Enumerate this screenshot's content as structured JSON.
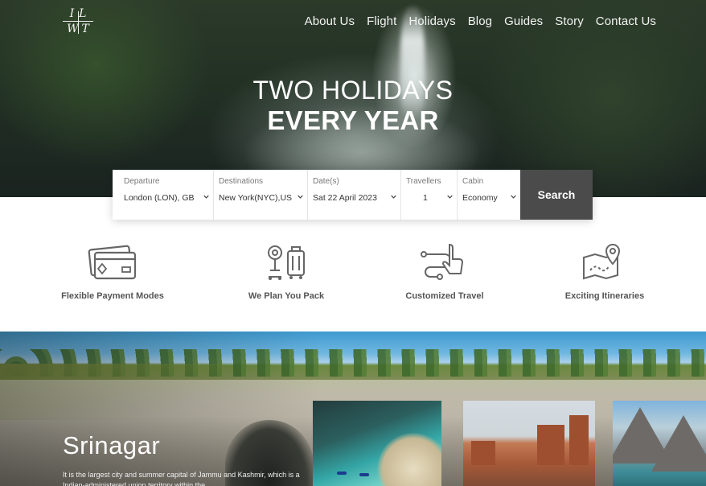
{
  "nav": {
    "logo_text": "IL WT",
    "links": [
      "About Us",
      "Flight",
      "Holidays",
      "Blog",
      "Guides",
      "Story",
      "Contact Us"
    ]
  },
  "hero": {
    "line1": "TWO HOLIDAYS",
    "line2": "EVERY YEAR"
  },
  "search": {
    "departure": {
      "label": "Departure",
      "value": "London (LON), GB"
    },
    "destinations": {
      "label": "Destinations",
      "value": "New York(NYC),US"
    },
    "dates": {
      "label": "Date(s)",
      "value": "Sat 22 April 2023"
    },
    "travellers": {
      "label": "Travellers",
      "value": "1"
    },
    "cabin": {
      "label": "Cabin",
      "value": "Economy"
    },
    "button": "Search"
  },
  "features": [
    {
      "title": "Flexible Payment Modes",
      "icon": "credit-card-icon"
    },
    {
      "title": "We Plan You Pack",
      "icon": "luggage-icon"
    },
    {
      "title": "Customized Travel",
      "icon": "touch-route-icon"
    },
    {
      "title": "Exciting Itineraries",
      "icon": "map-pin-icon"
    }
  ],
  "destination": {
    "city": "Srinagar",
    "description": "It is the largest city and summer capital of Jammu and Kashmir, which is a Indian-administered union territory within the"
  },
  "colors": {
    "search_button": "#4b4b4b",
    "icon_stroke": "#666666"
  }
}
